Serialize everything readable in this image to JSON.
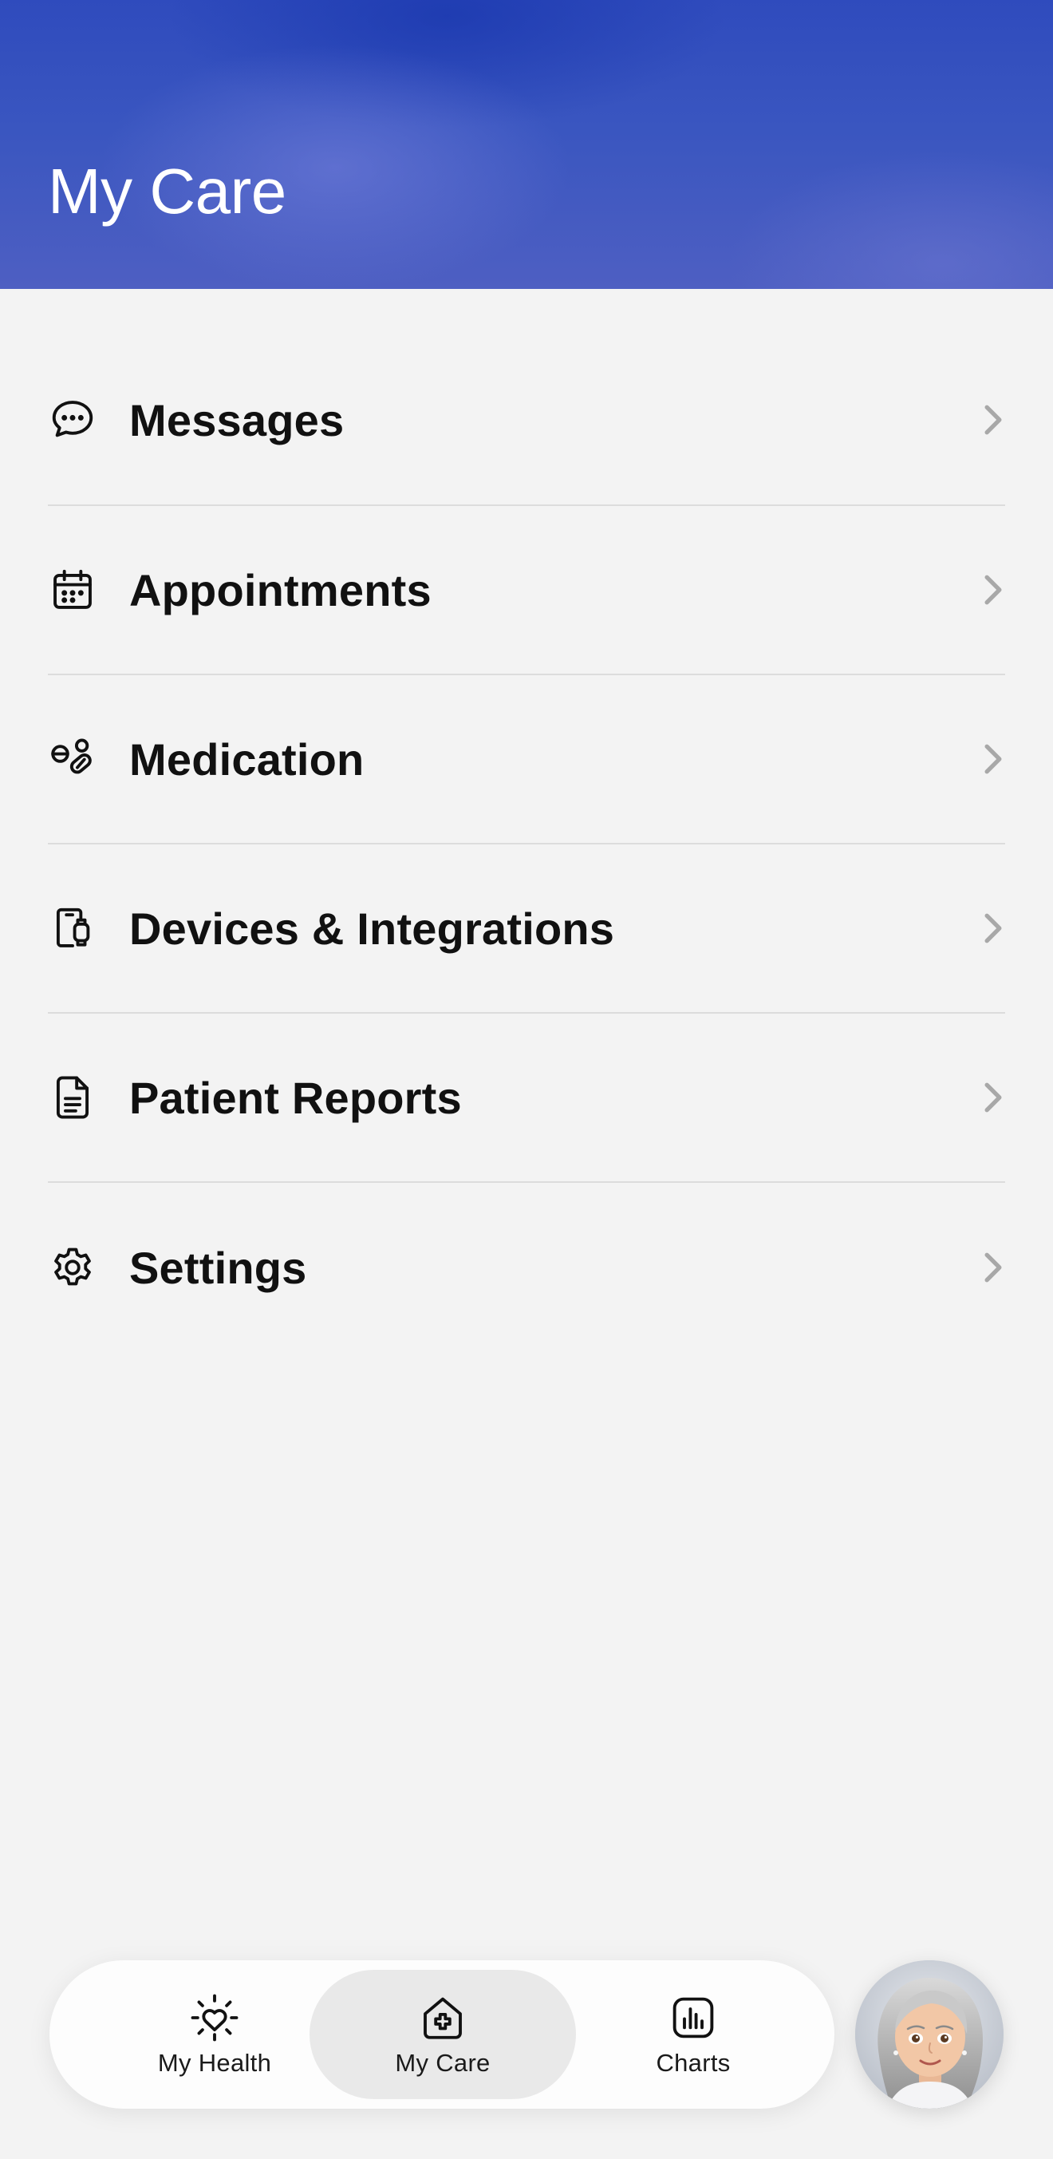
{
  "header": {
    "title": "My Care"
  },
  "menu": {
    "items": [
      {
        "label": "Messages",
        "icon": "chat-bubble-icon"
      },
      {
        "label": "Appointments",
        "icon": "calendar-icon"
      },
      {
        "label": "Medication",
        "icon": "pills-icon"
      },
      {
        "label": "Devices & Integrations",
        "icon": "phone-watch-icon"
      },
      {
        "label": "Patient Reports",
        "icon": "document-icon"
      },
      {
        "label": "Settings",
        "icon": "gear-icon"
      }
    ]
  },
  "bottom_nav": {
    "items": [
      {
        "label": "My Health",
        "icon": "heart-sun-icon",
        "active": false
      },
      {
        "label": "My Care",
        "icon": "house-plus-icon",
        "active": true
      },
      {
        "label": "Charts",
        "icon": "bar-chart-icon",
        "active": false
      }
    ]
  },
  "avatar": {
    "icon": "user-avatar"
  },
  "colors": {
    "header_top": "#2f4bbd",
    "header_bottom": "#4e5fc2",
    "background": "#f3f3f3",
    "chevron": "#a8a8a8",
    "active_tab": "#e9e9e9"
  }
}
